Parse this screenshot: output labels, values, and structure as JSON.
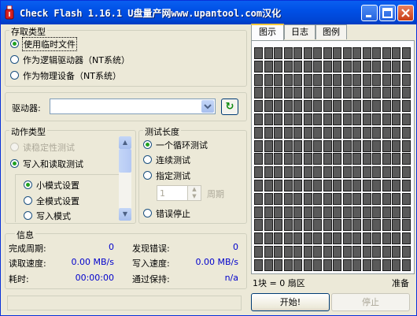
{
  "window": {
    "title": "Check Flash 1.16.1 U盘量产网www.upantool.com汉化"
  },
  "access_type": {
    "legend": "存取类型",
    "options": [
      {
        "label": "使用临时文件",
        "selected": true
      },
      {
        "label": "作为逻辑驱动器（NT系统）",
        "selected": false
      },
      {
        "label": "作为物理设备（NT系统）",
        "selected": false
      }
    ]
  },
  "drive": {
    "label": "驱动器:",
    "value": ""
  },
  "action_type": {
    "legend": "动作类型",
    "options": [
      {
        "label": "读稳定性测试",
        "selected": false,
        "disabled": true
      },
      {
        "label": "写入和读取测试",
        "selected": true,
        "disabled": false
      }
    ],
    "sub_options": [
      {
        "label": "小模式设置",
        "selected": true
      },
      {
        "label": "全模式设置",
        "selected": false
      },
      {
        "label": "写入模式",
        "selected": false
      }
    ]
  },
  "test_length": {
    "legend": "测试长度",
    "options": [
      {
        "label": "一个循环测试",
        "selected": true
      },
      {
        "label": "连续测试",
        "selected": false
      },
      {
        "label": "指定测试",
        "selected": false
      },
      {
        "label": "错误停止",
        "selected": false
      }
    ],
    "cycles_value": "1",
    "cycles_unit": "周期"
  },
  "info": {
    "legend": "信息",
    "completed_cycles_label": "完成周期:",
    "completed_cycles_value": "0",
    "errors_label": "发现错误:",
    "errors_value": "0",
    "read_speed_label": "读取速度:",
    "read_speed_value": "0.00 MB/s",
    "write_speed_label": "写入速度:",
    "write_speed_value": "0.00 MB/s",
    "elapsed_label": "耗时:",
    "elapsed_value": "00:00:00",
    "pass_hold_label": "通过保持:",
    "pass_hold_value": "n/a"
  },
  "tabs": [
    {
      "label": "图示",
      "active": true
    },
    {
      "label": "日志",
      "active": false
    },
    {
      "label": "图例",
      "active": false
    }
  ],
  "map": {
    "status_left": "1块 = 0 扇区",
    "status_right": "准备",
    "block_color": "#5a5a5a"
  },
  "buttons": {
    "start": "开始!",
    "stop": "停止"
  },
  "colors": {
    "title_bar": "#0054e3",
    "selected_radio": "#21a121",
    "value_text": "#0000cc"
  }
}
